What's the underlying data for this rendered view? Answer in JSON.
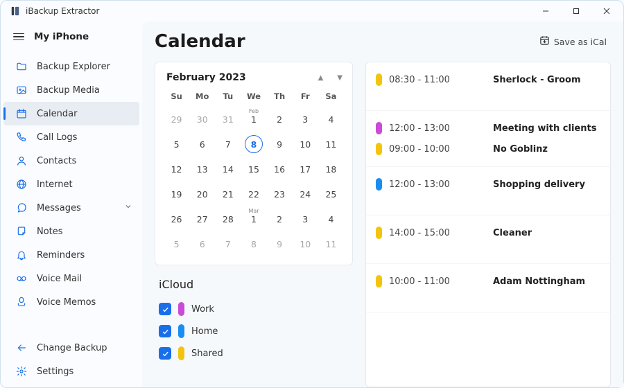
{
  "app": {
    "title": "iBackup Extractor"
  },
  "sidebar": {
    "header": "My iPhone",
    "items": [
      {
        "label": "Backup Explorer",
        "icon": "folder"
      },
      {
        "label": "Backup Media",
        "icon": "image"
      },
      {
        "label": "Calendar",
        "icon": "calendar",
        "active": true
      },
      {
        "label": "Call Logs",
        "icon": "phone"
      },
      {
        "label": "Contacts",
        "icon": "user"
      },
      {
        "label": "Internet",
        "icon": "globe"
      },
      {
        "label": "Messages",
        "icon": "chat",
        "expandable": true
      },
      {
        "label": "Notes",
        "icon": "note"
      },
      {
        "label": "Reminders",
        "icon": "bell"
      },
      {
        "label": "Voice Mail",
        "icon": "voicemail"
      },
      {
        "label": "Voice Memos",
        "icon": "mic"
      }
    ],
    "bottom": [
      {
        "label": "Change Backup",
        "icon": "back"
      },
      {
        "label": "Settings",
        "icon": "gear"
      }
    ]
  },
  "header": {
    "title": "Calendar",
    "save_label": "Save as iCal"
  },
  "calendar": {
    "month_label": "February 2023",
    "dow": [
      "Su",
      "Mo",
      "Tu",
      "We",
      "Th",
      "Fr",
      "Sa"
    ],
    "rows": [
      [
        {
          "n": "29",
          "dim": true
        },
        {
          "n": "30",
          "dim": true
        },
        {
          "n": "31",
          "dim": true
        },
        {
          "n": "1",
          "tag": "Feb"
        },
        {
          "n": "2"
        },
        {
          "n": "3"
        },
        {
          "n": "4"
        }
      ],
      [
        {
          "n": "5"
        },
        {
          "n": "6"
        },
        {
          "n": "7"
        },
        {
          "n": "8",
          "selected": true
        },
        {
          "n": "9"
        },
        {
          "n": "10"
        },
        {
          "n": "11"
        }
      ],
      [
        {
          "n": "12"
        },
        {
          "n": "13"
        },
        {
          "n": "14"
        },
        {
          "n": "15"
        },
        {
          "n": "16"
        },
        {
          "n": "17"
        },
        {
          "n": "18"
        }
      ],
      [
        {
          "n": "19"
        },
        {
          "n": "20"
        },
        {
          "n": "21"
        },
        {
          "n": "22"
        },
        {
          "n": "23"
        },
        {
          "n": "24"
        },
        {
          "n": "25"
        }
      ],
      [
        {
          "n": "26"
        },
        {
          "n": "27"
        },
        {
          "n": "28"
        },
        {
          "n": "1",
          "tag": "Mar"
        },
        {
          "n": "2"
        },
        {
          "n": "3"
        },
        {
          "n": "4"
        }
      ],
      [
        {
          "n": "5",
          "dim": true
        },
        {
          "n": "6",
          "dim": true
        },
        {
          "n": "7",
          "dim": true
        },
        {
          "n": "8",
          "dim": true
        },
        {
          "n": "9",
          "dim": true
        },
        {
          "n": "10",
          "dim": true
        },
        {
          "n": "11",
          "dim": true
        }
      ]
    ]
  },
  "calendars_section": {
    "title": "iCloud",
    "items": [
      {
        "label": "Work",
        "color": "purple",
        "checked": true
      },
      {
        "label": "Home",
        "color": "blue",
        "checked": true
      },
      {
        "label": "Shared",
        "color": "yellow",
        "checked": true
      }
    ]
  },
  "events": [
    {
      "rows": [
        {
          "color": "yellow",
          "time": "08:30 - 11:00",
          "title": "Sherlock - Groom"
        }
      ]
    },
    {
      "rows": [
        {
          "color": "purple",
          "time": "12:00 - 13:00",
          "title": "Meeting with clients"
        },
        {
          "color": "yellow",
          "time": "09:00 - 10:00",
          "title": "No Goblinz"
        }
      ]
    },
    {
      "rows": [
        {
          "color": "blue",
          "time": "12:00 - 13:00",
          "title": "Shopping delivery"
        }
      ]
    },
    {
      "rows": [
        {
          "color": "yellow",
          "time": "14:00 - 15:00",
          "title": "Cleaner"
        }
      ]
    },
    {
      "rows": [
        {
          "color": "yellow",
          "time": "10:00 - 11:00",
          "title": "Adam Nottingham"
        }
      ]
    }
  ]
}
